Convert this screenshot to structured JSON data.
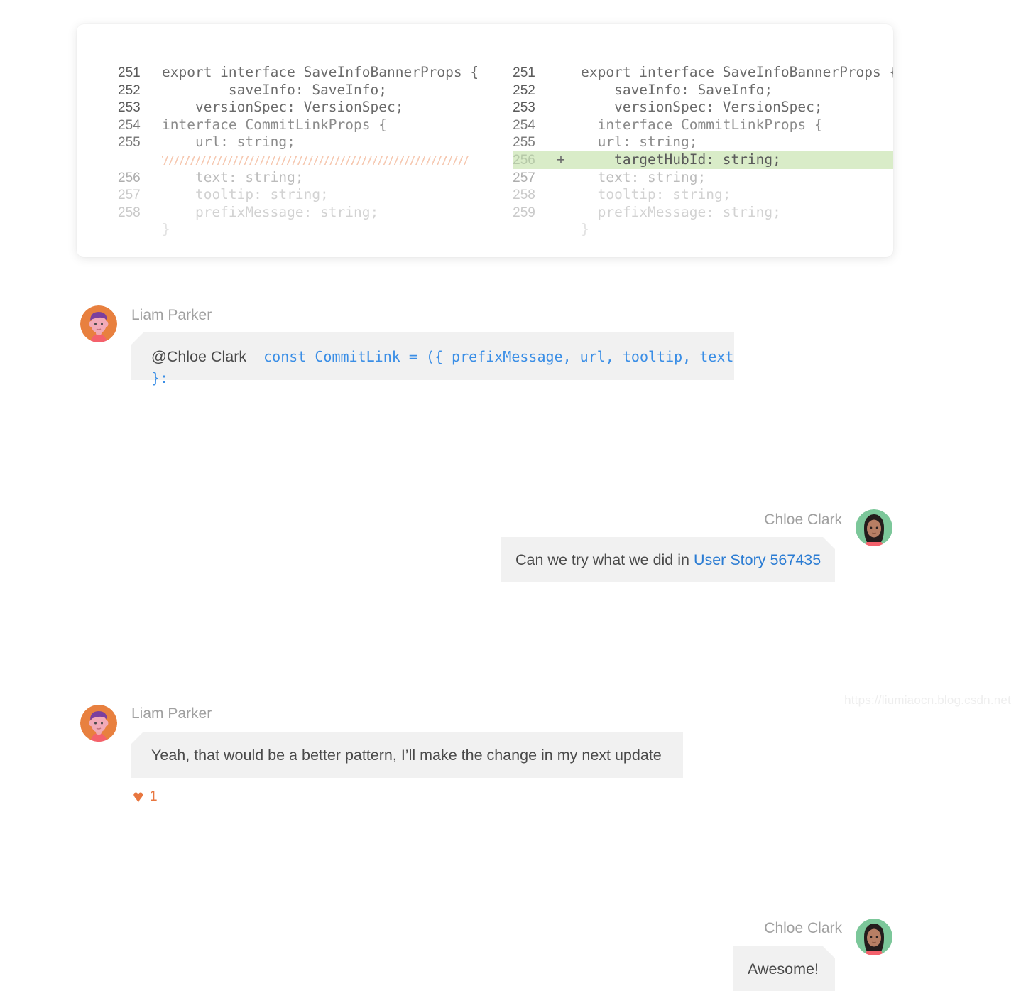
{
  "diff": {
    "left": {
      "lines": [
        {
          "num": "251",
          "indent": 0,
          "text": "export interface SaveInfoBannerProps {",
          "fade": 0,
          "marker": ""
        },
        {
          "num": "252",
          "indent": 4,
          "text": "saveInfo: SaveInfo;",
          "fade": 0,
          "marker": ""
        },
        {
          "num": "253",
          "indent": 2,
          "text": "versionSpec: VersionSpec;",
          "fade": 0,
          "marker": ""
        },
        {
          "num": "254",
          "indent": 0,
          "text": "interface CommitLinkProps {",
          "fade": 1,
          "marker": ""
        },
        {
          "num": "255",
          "indent": 2,
          "text": "url: string;",
          "fade": 1,
          "marker": ""
        },
        {
          "num": "256",
          "indent": 2,
          "text": "text: string;",
          "fade": 2,
          "marker": ""
        },
        {
          "num": "257",
          "indent": 2,
          "text": "tooltip: string;",
          "fade": 3,
          "marker": ""
        },
        {
          "num": "258",
          "indent": 2,
          "text": "prefixMessage: string;",
          "fade": 3,
          "marker": ""
        },
        {
          "num": "",
          "indent": 0,
          "text": "}",
          "fade": 4,
          "marker": ""
        }
      ],
      "hatch_after_index": 4
    },
    "right": {
      "lines": [
        {
          "num": "251",
          "indent": 0,
          "text": "export interface SaveInfoBannerProps {",
          "fade": 0,
          "marker": ""
        },
        {
          "num": "252",
          "indent": 2,
          "text": "saveInfo: SaveInfo;",
          "fade": 0,
          "marker": ""
        },
        {
          "num": "253",
          "indent": 2,
          "text": "versionSpec: VersionSpec;",
          "fade": 0,
          "marker": ""
        },
        {
          "num": "254",
          "indent": 1,
          "text": "interface CommitLinkProps {",
          "fade": 1,
          "marker": ""
        },
        {
          "num": "255",
          "indent": 1,
          "text": "url: string;",
          "fade": 1,
          "marker": ""
        },
        {
          "num": "256",
          "indent": 2,
          "text": "targetHubId: string;",
          "fade": 0,
          "marker": "+",
          "added": true
        },
        {
          "num": "257",
          "indent": 1,
          "text": "text: string;",
          "fade": 2,
          "marker": ""
        },
        {
          "num": "258",
          "indent": 1,
          "text": "tooltip: string;",
          "fade": 3,
          "marker": ""
        },
        {
          "num": "259",
          "indent": 1,
          "text": "prefixMessage: string;",
          "fade": 3,
          "marker": ""
        },
        {
          "num": "",
          "indent": 0,
          "text": "}",
          "fade": 4,
          "marker": ""
        }
      ]
    }
  },
  "thread": {
    "messages": [
      {
        "author": "Liam Parker",
        "side": "left",
        "avatar": "liam-avatar",
        "mention": "@Chloe Clark",
        "code": "const CommitLink = ({ prefixMessage, url, tooltip, text }:",
        "text": "",
        "link_text": "",
        "reaction": null
      },
      {
        "author": "Chloe Clark",
        "side": "right",
        "avatar": "chloe-avatar",
        "mention": "",
        "code": "",
        "text": "Can we try what we did in ",
        "link_text": "User Story 567435",
        "reaction": null
      },
      {
        "author": "Liam Parker",
        "side": "left",
        "avatar": "liam-avatar",
        "mention": "",
        "code": "",
        "text": "Yeah, that would be a better pattern, I’ll make the change in my next update",
        "link_text": "",
        "reaction": {
          "icon": "heart-icon",
          "glyph": "♥",
          "count": "1"
        }
      },
      {
        "author": "Chloe Clark",
        "side": "right",
        "avatar": "chloe-avatar",
        "mention": "",
        "code": "",
        "text": "Awesome!",
        "link_text": "",
        "reaction": null
      }
    ]
  },
  "watermark": {
    "text": "https://liumiaocn.blog.csdn.net"
  },
  "colors": {
    "added_bg": "#d9ecc8",
    "bubble_bg": "#f1f1f1",
    "link": "#2b7cd3",
    "code_blue": "#3a8ee6",
    "heart": "#e8763f",
    "hatch": "#f6c9b2",
    "liam_avatar_bg": "#e8803f",
    "chloe_avatar_bg": "#7cc79a"
  }
}
